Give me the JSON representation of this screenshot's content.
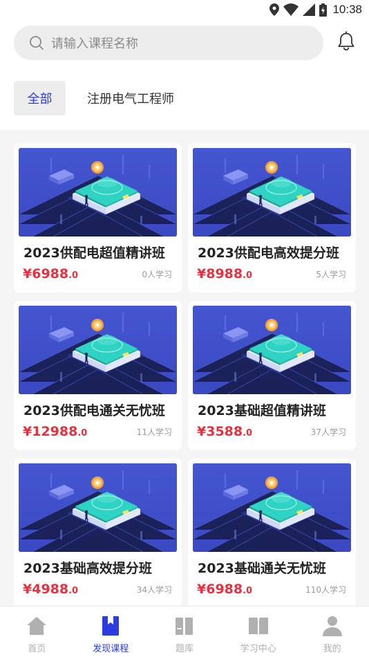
{
  "status_bar": {
    "time": "10:38"
  },
  "search": {
    "placeholder": "请输入课程名称"
  },
  "categories": [
    {
      "label": "全部",
      "active": true
    },
    {
      "label": "注册电气工程师",
      "active": false
    }
  ],
  "courses": [
    {
      "title": "2023供配电超值精讲班",
      "price": "¥6988",
      "price_decimal": ".0",
      "learners": "0人学习"
    },
    {
      "title": "2023供配电高效提分班",
      "price": "¥8988",
      "price_decimal": ".0",
      "learners": "5人学习"
    },
    {
      "title": "2023供配电通关无忧班",
      "price": "¥12988",
      "price_decimal": ".0",
      "learners": "11人学习"
    },
    {
      "title": "2023基础超值精讲班",
      "price": "¥3588",
      "price_decimal": ".0",
      "learners": "37人学习"
    },
    {
      "title": "2023基础高效提分班",
      "price": "¥4988",
      "price_decimal": ".0",
      "learners": "34人学习"
    },
    {
      "title": "2023基础通关无忧班",
      "price": "¥6988",
      "price_decimal": ".0",
      "learners": "110人学习"
    }
  ],
  "bottom_nav": [
    {
      "label": "首页",
      "icon": "home-icon",
      "active": false
    },
    {
      "label": "发现课程",
      "icon": "bookmark-icon",
      "active": true
    },
    {
      "label": "题库",
      "icon": "books-icon",
      "active": false
    },
    {
      "label": "学习中心",
      "icon": "open-book-icon",
      "active": false
    },
    {
      "label": "我的",
      "icon": "person-icon",
      "active": false
    }
  ],
  "colors": {
    "accent": "#2b3ce0",
    "price": "#e8303f",
    "thumbnail_bg": "#3f4fc9",
    "inactive_nav": "#b0b0b0"
  }
}
